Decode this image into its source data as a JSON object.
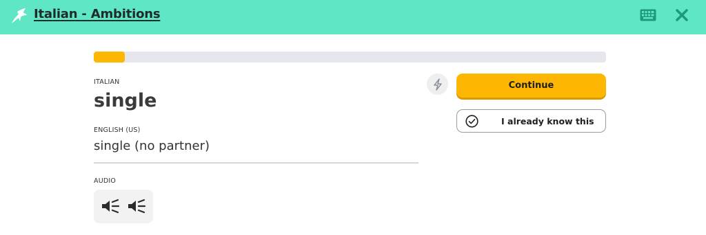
{
  "header": {
    "course_title": "Italian - Ambitions",
    "background_color": "#5fe6c4",
    "icons": [
      "logo-icon",
      "keyboard-icon",
      "close-icon"
    ]
  },
  "progress": {
    "fraction": 0.06,
    "fill_color": "#fdb702"
  },
  "card": {
    "source_label": "ITALIAN",
    "word": "single",
    "target_label": "ENGLISH (US)",
    "translation": "single (no partner)",
    "audio_label": "AUDIO"
  },
  "actions": {
    "continue_label": "Continue",
    "know_label": "I already know this",
    "accent_color": "#fdb702"
  }
}
